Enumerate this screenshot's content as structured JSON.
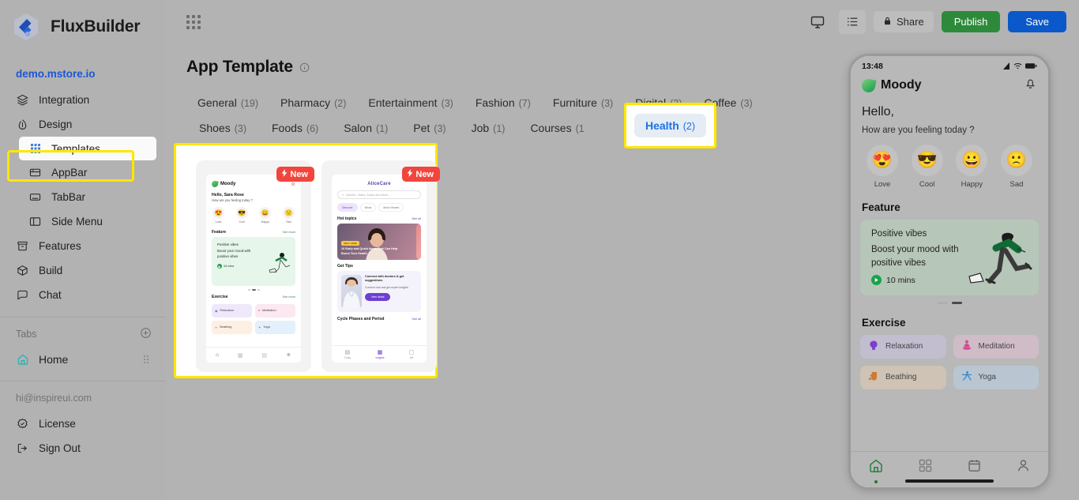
{
  "app": {
    "brand": "FluxBuilder",
    "site_link": "demo.mstore.io"
  },
  "sidebar": {
    "nav": [
      {
        "label": "Integration",
        "icon": "layers-icon",
        "sub": false,
        "active": false
      },
      {
        "label": "Design",
        "icon": "droplet-icon",
        "sub": false,
        "active": false
      },
      {
        "label": "Templates",
        "icon": "grid-dots-icon",
        "sub": true,
        "active": true
      },
      {
        "label": "AppBar",
        "icon": "appbar-icon",
        "sub": true,
        "active": false
      },
      {
        "label": "TabBar",
        "icon": "tabbar-icon",
        "sub": true,
        "active": false
      },
      {
        "label": "Side Menu",
        "icon": "sidemenu-icon",
        "sub": true,
        "active": false
      },
      {
        "label": "Features",
        "icon": "archive-icon",
        "sub": false,
        "active": false
      },
      {
        "label": "Build",
        "icon": "cube-icon",
        "sub": false,
        "active": false
      },
      {
        "label": "Chat",
        "icon": "chat-icon",
        "sub": false,
        "active": false
      }
    ],
    "tabs_section": {
      "label": "Tabs",
      "add_icon": "plus-circle-icon"
    },
    "tabs": [
      {
        "label": "Home",
        "icon": "home-icon"
      }
    ],
    "account_email": "hi@inspireui.com",
    "footer": [
      {
        "label": "License",
        "icon": "badge-check-icon"
      },
      {
        "label": "Sign Out",
        "icon": "logout-icon"
      }
    ]
  },
  "topbar": {
    "apps_icon": "grid-apps-icon",
    "preview_icon": "monitor-icon",
    "list_icon": "list-icon",
    "share_label": "Share",
    "share_icon": "lock-icon",
    "publish_label": "Publish",
    "save_label": "Save",
    "colors": {
      "publish": "#2e8a3b",
      "save": "#0a58ca",
      "accent": "#1a73e8",
      "highlight": "#ffe600"
    }
  },
  "page": {
    "title": "App Template",
    "info_icon": "info-icon",
    "categories_row1": [
      {
        "label": "General",
        "count": "(19)",
        "selected": false
      },
      {
        "label": "Pharmacy",
        "count": "(2)",
        "selected": false
      },
      {
        "label": "Entertainment",
        "count": "(3)",
        "selected": false
      },
      {
        "label": "Fashion",
        "count": "(7)",
        "selected": false
      },
      {
        "label": "Furniture",
        "count": "(3)",
        "selected": false
      },
      {
        "label": "Digital",
        "count": "(3)",
        "selected": false
      },
      {
        "label": "Coffee",
        "count": "(3)",
        "selected": false
      }
    ],
    "categories_row2": [
      {
        "label": "Shoes",
        "count": "(3)",
        "selected": false
      },
      {
        "label": "Foods",
        "count": "(6)",
        "selected": false
      },
      {
        "label": "Salon",
        "count": "(1)",
        "selected": false
      },
      {
        "label": "Pet",
        "count": "(3)",
        "selected": false
      },
      {
        "label": "Job",
        "count": "(1)",
        "selected": false
      },
      {
        "label": "Courses",
        "count": "(1",
        "selected": false
      }
    ],
    "selected_category": {
      "label": "Health",
      "count": "(2)"
    }
  },
  "templates": [
    {
      "name": "Moody",
      "badge": "New",
      "badge_icon": "bolt-icon",
      "greeting": "Hello, Sara Rose",
      "question": "How are you feeling today ?",
      "moods": [
        "Love",
        "Cool",
        "Happy",
        "Sad"
      ],
      "feature_heading": "Feature",
      "feature_see": "See more",
      "feature_title": "Positive vibes",
      "feature_desc": "Boost your mood with positive vibes",
      "feature_duration": "10 mins",
      "exercise_heading": "Exercise",
      "exercise_see": "See more",
      "exercises": [
        "Relaxation",
        "Meditation",
        "Beathing",
        "Yoga"
      ]
    },
    {
      "name": "AliceCare",
      "badge": "New",
      "badge_icon": "bolt-icon",
      "search_placeholder": "Articles, Video, Audio and More...",
      "chips": [
        "Discover",
        "News",
        "Most Viewed"
      ],
      "hot_topics_heading": "Hot topics",
      "hot_topics_see": "See all",
      "hero_tag": "SELF CARE",
      "hero_title": "10 Early and Quick Ideas That Can Help Boost Your Health",
      "tips_heading": "Get Tips",
      "tips_title": "Connect with doctors & get suggestions",
      "tips_desc": "Connect now and get expert insights",
      "tips_button": "View detail",
      "cycle_heading": "Cycle Phases and Period",
      "cycle_see": "See all",
      "nav": [
        "Today",
        "Insights",
        "Me"
      ]
    }
  ],
  "preview": {
    "status_time": "13:48",
    "status_icons": [
      "signal-icon",
      "wifi-icon",
      "battery-icon"
    ],
    "app_name": "Moody",
    "bell_icon": "bell-icon",
    "hello": "Hello,",
    "question": "How are you feeling today ?",
    "moods": [
      {
        "label": "Love",
        "emoji": "😍"
      },
      {
        "label": "Cool",
        "emoji": "😎"
      },
      {
        "label": "Happy",
        "emoji": "😀"
      },
      {
        "label": "Sad",
        "emoji": "🙁"
      }
    ],
    "feature_heading": "Feature",
    "feature_title": "Positive vibes",
    "feature_desc": "Boost your mood with positive vibes",
    "feature_duration": "10 mins",
    "exercise_heading": "Exercise",
    "exercises": [
      {
        "label": "Relaxation",
        "icon": "brain-icon"
      },
      {
        "label": "Meditation",
        "icon": "meditation-icon"
      },
      {
        "label": "Beathing",
        "icon": "breathing-icon"
      },
      {
        "label": "Yoga",
        "icon": "yoga-icon"
      }
    ],
    "nav": [
      "home-icon",
      "apps-icon",
      "calendar-icon",
      "profile-icon"
    ]
  }
}
